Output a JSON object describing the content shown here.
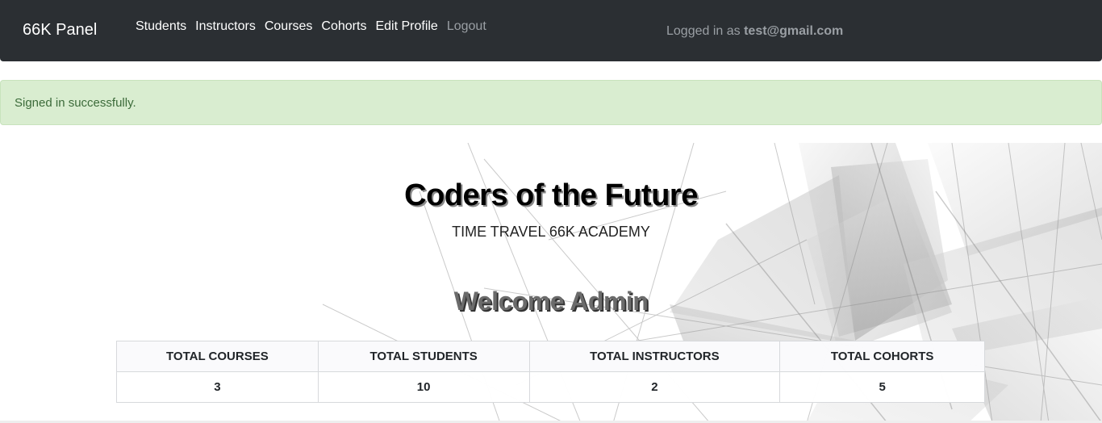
{
  "navbar": {
    "brand": "66K Panel",
    "links": [
      {
        "label": "Students"
      },
      {
        "label": "Instructors"
      },
      {
        "label": "Courses"
      },
      {
        "label": "Cohorts"
      },
      {
        "label": "Edit Profile"
      },
      {
        "label": "Logout"
      }
    ],
    "logged_in_prefix": "Logged in as",
    "logged_in_user": "test@gmail.com"
  },
  "alert": {
    "message": "Signed in successfully.",
    "color": "#d9edd0"
  },
  "hero": {
    "title": "Coders of the Future",
    "subtitle": "TIME TRAVEL 66K ACADEMY",
    "welcome": "Welcome Admin"
  },
  "stats": {
    "headers": [
      "TOTAL COURSES",
      "TOTAL STUDENTS",
      "TOTAL INSTRUCTORS",
      "TOTAL COHORTS"
    ],
    "values": [
      "3",
      "10",
      "2",
      "5"
    ]
  },
  "colors": {
    "navbar_bg": "#2b2f33",
    "nav_muted": "#9a9fa4",
    "alert_text": "#3c6b3a"
  }
}
